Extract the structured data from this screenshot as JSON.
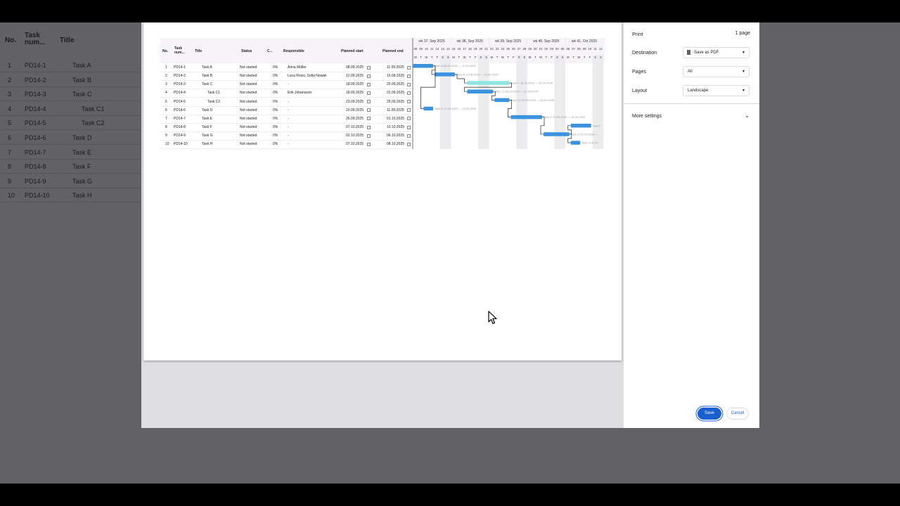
{
  "background_table": {
    "headers": {
      "no": "No.",
      "task_num": "Task num...",
      "title": "Title"
    },
    "rows": [
      {
        "no": "1",
        "task": "PD14-1",
        "title": "Task A"
      },
      {
        "no": "2",
        "task": "PD14-2",
        "title": "Task B"
      },
      {
        "no": "3",
        "task": "PD14-3",
        "title": "Task C"
      },
      {
        "no": "4",
        "task": "PD14-4",
        "title": "Task C1"
      },
      {
        "no": "5",
        "task": "PD14-5",
        "title": "Task C2"
      },
      {
        "no": "6",
        "task": "PD14-6",
        "title": "Task D"
      },
      {
        "no": "7",
        "task": "PD14-7",
        "title": "Task E"
      },
      {
        "no": "8",
        "task": "PD14-8",
        "title": "Task F"
      },
      {
        "no": "9",
        "task": "PD14-9",
        "title": "Task G"
      },
      {
        "no": "10",
        "task": "PD14-10",
        "title": "Task H"
      }
    ]
  },
  "preview": {
    "headers": {
      "no": "No.",
      "task_num": "Task num...",
      "title": "Title",
      "status": "Status",
      "c": "C...",
      "responsible": "Responsible",
      "planned_start": "Planned start",
      "planned_end": "Planned end"
    },
    "weeks": [
      "wk 37, Sep 2025",
      "wk 38, Sep 2025",
      "wk 39, Sep 2025",
      "wk 40, Sep 2025",
      "wk 41, Oct 2025"
    ],
    "days": [
      "08",
      "09",
      "10",
      "11",
      "12",
      "13",
      "14",
      "15",
      "16",
      "17",
      "18",
      "19",
      "20",
      "21",
      "22",
      "23",
      "24",
      "25",
      "26",
      "27",
      "28",
      "29",
      "30",
      "01",
      "02",
      "03",
      "04",
      "05",
      "06",
      "07",
      "08",
      "09",
      "10",
      "11",
      "12"
    ],
    "dows": [
      "M",
      "T",
      "W",
      "T",
      "F",
      "S",
      "S",
      "M",
      "T",
      "W",
      "T",
      "F",
      "S",
      "S",
      "M",
      "T",
      "W",
      "T",
      "F",
      "S",
      "S",
      "M",
      "T",
      "W",
      "T",
      "F",
      "S",
      "S",
      "M",
      "T",
      "W",
      "T",
      "F",
      "S",
      "S"
    ],
    "rows": [
      {
        "no": "1",
        "task": "PD14-1",
        "title": "Task A",
        "status": "Not started",
        "c": "0%",
        "resp": "Anna Müller",
        "start": "08.09.2025",
        "end": "11.09.2025",
        "bar_label": "Task A 08.09.2025 — 11.09.2025"
      },
      {
        "no": "2",
        "task": "PD14-2",
        "title": "Task B",
        "status": "Not started",
        "c": "0%",
        "resp": "Luca Rossi, Sofia Nowak",
        "start": "12.09.2025",
        "end": "15.09.2025",
        "bar_label": "Task B 12.09.2025 — 15.09.2025"
      },
      {
        "no": "3",
        "task": "PD14-3",
        "title": "Task C",
        "status": "Not started",
        "c": "0%",
        "resp": "-",
        "start": "18.09.2025",
        "end": "25.09.2025",
        "bar_label": "Task C 18.09.2025 — 25.09.2025"
      },
      {
        "no": "4",
        "task": "PD14-4",
        "title": "Task C1",
        "status": "Not started",
        "c": "0%",
        "resp": "Erik Johansson",
        "start": "18.09.2025",
        "end": "22.09.2025",
        "bar_label": "Task C1 18.09.2025 — 22.09.2025"
      },
      {
        "no": "5",
        "task": "PD14-5",
        "title": "Task C2",
        "status": "Not started",
        "c": "0%",
        "resp": "-",
        "start": "23.09.2025",
        "end": "25.09.2025",
        "bar_label": "Task C2 23.09.2025 — 25.09.2025"
      },
      {
        "no": "6",
        "task": "PD14-6",
        "title": "Task D",
        "status": "Not started",
        "c": "0%",
        "resp": "-",
        "start": "10.09.2025",
        "end": "11.09.2025",
        "bar_label": "Task D 10.09.2025 — 11.09.2025"
      },
      {
        "no": "7",
        "task": "PD14-7",
        "title": "Task E",
        "status": "Not started",
        "c": "0%",
        "resp": "-",
        "start": "26.09.2025",
        "end": "01.10.2025",
        "bar_label": "Task E 26.09.2025 — 01.10.2025"
      },
      {
        "no": "8",
        "task": "PD14-8",
        "title": "Task F",
        "status": "Not started",
        "c": "0%",
        "resp": "-",
        "start": "07.10.2025",
        "end": "10.10.2025",
        "bar_label": "Task F"
      },
      {
        "no": "9",
        "task": "PD14-9",
        "title": "Task G",
        "status": "Not started",
        "c": "0%",
        "resp": "-",
        "start": "02.10.2025",
        "end": "06.10.2025",
        "bar_label": "Task G 02.10.2025 —"
      },
      {
        "no": "10",
        "task": "PD14-10",
        "title": "Task H",
        "status": "Not started",
        "c": "0%",
        "resp": "-",
        "start": "07.10.2025",
        "end": "08.10.2025",
        "bar_label": "Task H 07.10"
      }
    ]
  },
  "print_panel": {
    "title": "Print",
    "page_count": "1 page",
    "destination_label": "Destination",
    "destination_value": "Save as PDF",
    "pages_label": "Pages",
    "pages_value": "All",
    "layout_label": "Layout",
    "layout_value": "Landscape",
    "more_settings": "More settings",
    "save": "Save",
    "cancel": "Cancel"
  },
  "colors": {
    "bar": "#3b93df",
    "bar_parent": "#8de6e1",
    "save_button": "#1a5fd0"
  }
}
